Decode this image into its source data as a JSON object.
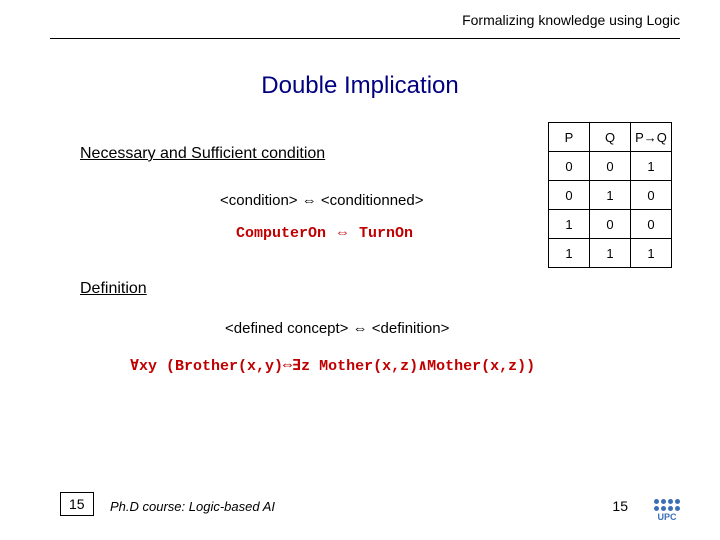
{
  "header": "Formalizing knowledge using Logic",
  "title": "Double Implication",
  "nsc_label": "Necessary and Sufficient condition",
  "cond_template": "<condition> ⇔ <conditionned>",
  "example1_left": "ComputerOn",
  "example1_arrow": "⇔",
  "example1_right": "TurnOn",
  "defn_label": "Definition",
  "defn_template": "<defined concept> ⇔ <definition>",
  "example2": "∀xy (Brother(x,y)⇔∃z Mother(x,z)∧Mother(x,z))",
  "truth_table": {
    "headers": [
      "P",
      "Q",
      "P→Q"
    ],
    "rows": [
      [
        "0",
        "0",
        "1"
      ],
      [
        "0",
        "1",
        "0"
      ],
      [
        "1",
        "0",
        "0"
      ],
      [
        "1",
        "1",
        "1"
      ]
    ]
  },
  "footer": {
    "box_num": "15",
    "course": "Ph.D course: Logic-based AI",
    "page_num": "15",
    "logo": "UPC"
  }
}
